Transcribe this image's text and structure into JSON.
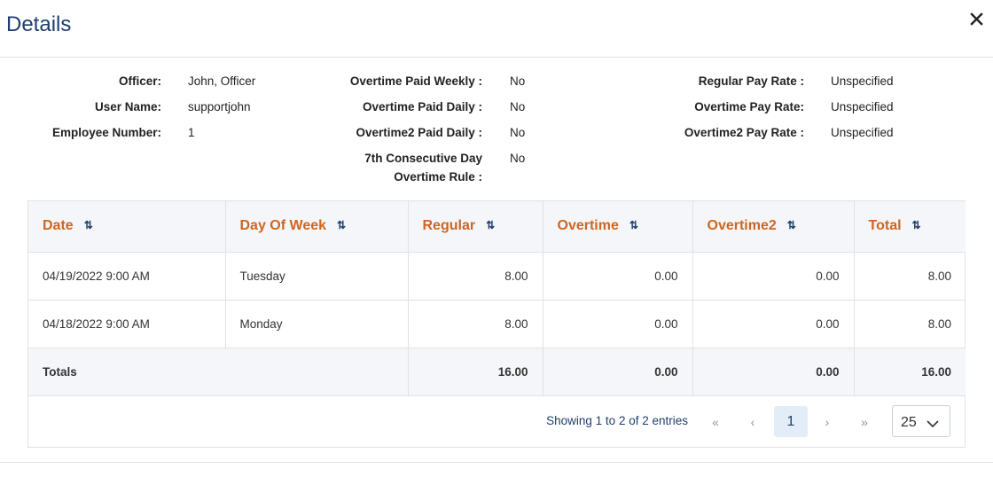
{
  "header": {
    "title": "Details",
    "close_icon": "close-icon"
  },
  "info": {
    "officer_label": "Officer:",
    "officer_value": "John, Officer",
    "username_label": "User Name:",
    "username_value": "supportjohn",
    "employee_number_label": "Employee Number:",
    "employee_number_value": "1",
    "ot_weekly_label": "Overtime Paid Weekly :",
    "ot_weekly_value": "No",
    "ot_daily_label": "Overtime Paid Daily :",
    "ot_daily_value": "No",
    "ot2_daily_label": "Overtime2 Paid Daily :",
    "ot2_daily_value": "No",
    "seventh_day_label_line1": "7th Consecutive Day",
    "seventh_day_label_line2": "Overtime Rule :",
    "seventh_day_value": "No",
    "regular_rate_label": "Regular Pay Rate :",
    "regular_rate_value": "Unspecified",
    "ot_rate_label": "Overtime Pay Rate:",
    "ot_rate_value": "Unspecified",
    "ot2_rate_label": "Overtime2 Pay Rate :",
    "ot2_rate_value": "Unspecified"
  },
  "table": {
    "columns": [
      "Date",
      "Day Of Week",
      "Regular",
      "Overtime",
      "Overtime2",
      "Total"
    ],
    "sort_glyph": "⇅",
    "rows": [
      {
        "date": "04/19/2022 9:00 AM",
        "day": "Tuesday",
        "regular": "8.00",
        "overtime": "0.00",
        "overtime2": "0.00",
        "total": "8.00"
      },
      {
        "date": "04/18/2022 9:00 AM",
        "day": "Monday",
        "regular": "8.00",
        "overtime": "0.00",
        "overtime2": "0.00",
        "total": "8.00"
      }
    ],
    "totals": {
      "label": "Totals",
      "regular": "16.00",
      "overtime": "0.00",
      "overtime2": "0.00",
      "total": "16.00"
    }
  },
  "pagination": {
    "entries_text": "Showing 1 to 2 of 2 entries",
    "first": "«",
    "prev": "‹",
    "current_page": "1",
    "next": "›",
    "last": "»",
    "page_size": "25"
  },
  "colors": {
    "title": "#1f3e6e",
    "header_text": "#d0651e",
    "header_bg": "#f4f6f9",
    "active_page_bg": "#e3edf8"
  }
}
